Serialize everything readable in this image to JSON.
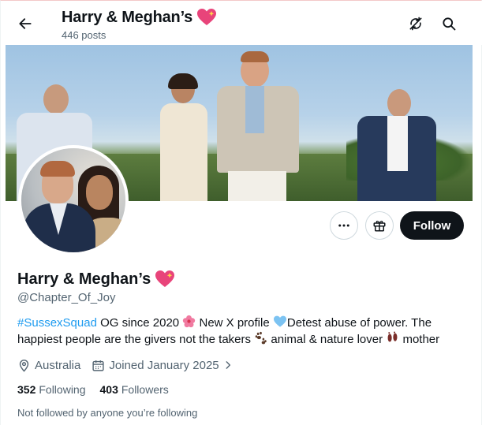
{
  "header": {
    "title": "Harry & Meghan’s",
    "posts_count": "446 posts",
    "back_icon": "arrow-left-icon",
    "sync_icon": "sync-off-icon",
    "search_icon": "search-icon"
  },
  "profile": {
    "name": "Harry & Meghan’s",
    "name_emoji": "sparkling-heart-icon",
    "handle": "@Chapter_Of_Joy",
    "bio": {
      "hashtag": "#SussexSquad",
      "part1": " OG since 2020 ",
      "part2": " New X profile ",
      "part3": "Detest abuse of power. The happiest people are the givers not the takers ",
      "part4": " animal & nature lover ",
      "part5": " mother"
    },
    "location": "Australia",
    "joined": "Joined January 2025",
    "following_count": "352",
    "following_label": "Following",
    "followers_count": "403",
    "followers_label": "Followers",
    "mutual_note": "Not followed by anyone you’re following"
  },
  "actions": {
    "more_icon": "more-dots-icon",
    "gift_icon": "gift-icon",
    "follow_label": "Follow"
  },
  "colors": {
    "accent": "#1d9bf0",
    "text": "#0f1419",
    "muted": "#536471",
    "heart": "#e8447a",
    "follow_bg": "#0f1419"
  }
}
